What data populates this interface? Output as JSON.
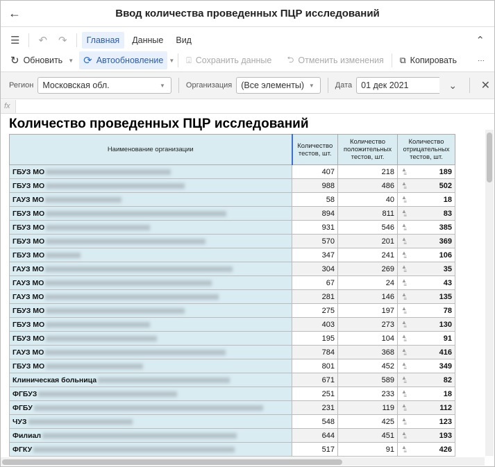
{
  "window": {
    "title": "Ввод количества проведенных ПЦР исследований"
  },
  "menu": {
    "tabs": [
      "Главная",
      "Данные",
      "Вид"
    ]
  },
  "toolbar": {
    "refresh": "Обновить",
    "autorefresh": "Автообновление",
    "save": "Сохранить данные",
    "cancel": "Отменить изменения",
    "copy": "Копировать",
    "more": "···"
  },
  "filters": {
    "region_label": "Регион",
    "region_value": "Московская обл.",
    "org_label": "Организация",
    "org_value": "(Все элементы)",
    "date_label": "Дата",
    "date_value": "01 дек 2021"
  },
  "formula": {
    "fx": "fx"
  },
  "sheet": {
    "title": "Количество проведенных ПЦР исследований",
    "headers": [
      "Наименование организации",
      "Количество тестов, шт.",
      "Количество положительных тестов, шт.",
      "Количество отрицательных тестов, шт."
    ],
    "rows": [
      [
        "ГБУЗ МО",
        "407",
        "218",
        "189"
      ],
      [
        "ГБУЗ МО",
        "988",
        "486",
        "502"
      ],
      [
        "ГАУЗ МО",
        "58",
        "40",
        "18"
      ],
      [
        "ГБУЗ МО",
        "894",
        "811",
        "83"
      ],
      [
        "ГБУЗ МО",
        "931",
        "546",
        "385"
      ],
      [
        "ГБУЗ МО",
        "570",
        "201",
        "369"
      ],
      [
        "ГБУЗ МО",
        "347",
        "241",
        "106"
      ],
      [
        "ГАУЗ МО",
        "304",
        "269",
        "35"
      ],
      [
        "ГАУЗ МО",
        "67",
        "24",
        "43"
      ],
      [
        "ГАУЗ МО",
        "281",
        "146",
        "135"
      ],
      [
        "ГБУЗ МО",
        "275",
        "197",
        "78"
      ],
      [
        "ГБУЗ МО",
        "403",
        "273",
        "130"
      ],
      [
        "ГБУЗ МО",
        "195",
        "104",
        "91"
      ],
      [
        "ГАУЗ МО",
        "784",
        "368",
        "416"
      ],
      [
        "ГБУЗ МО",
        "801",
        "452",
        "349"
      ],
      [
        "Клиническая больница",
        "671",
        "589",
        "82"
      ],
      [
        "ФГБУЗ",
        "251",
        "233",
        "18"
      ],
      [
        "ФГБУ",
        "231",
        "119",
        "112"
      ],
      [
        "ЧУЗ",
        "548",
        "425",
        "123"
      ],
      [
        "Филиал",
        "644",
        "451",
        "193"
      ],
      [
        "ФГКУ",
        "517",
        "91",
        "426"
      ]
    ]
  }
}
